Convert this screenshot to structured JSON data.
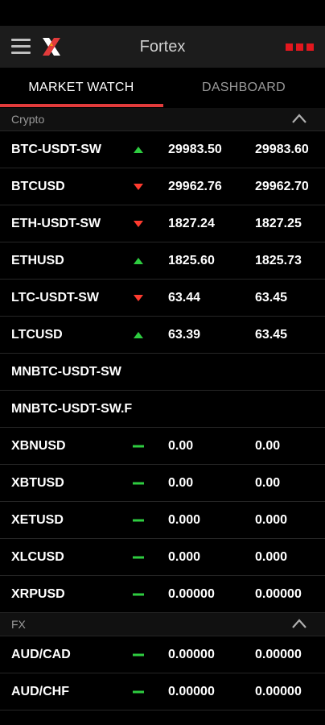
{
  "app": {
    "title": "Fortex"
  },
  "tabs": [
    {
      "label": "MARKET WATCH",
      "active": true
    },
    {
      "label": "DASHBOARD",
      "active": false
    }
  ],
  "sections": [
    {
      "name": "Crypto",
      "collapse_icon": "chevron-up-icon"
    },
    {
      "name": "FX",
      "collapse_icon": "chevron-up-icon"
    }
  ],
  "rows": [
    {
      "symbol": "BTC-USDT-SW",
      "trend": "up",
      "bid": "29983.50",
      "ask": "29983.60"
    },
    {
      "symbol": "BTCUSD",
      "trend": "down",
      "bid": "29962.76",
      "ask": "29962.70"
    },
    {
      "symbol": "ETH-USDT-SW",
      "trend": "down",
      "bid": "1827.24",
      "ask": "1827.25"
    },
    {
      "symbol": "ETHUSD",
      "trend": "up",
      "bid": "1825.60",
      "ask": "1825.73"
    },
    {
      "symbol": "LTC-USDT-SW",
      "trend": "down",
      "bid": "63.44",
      "ask": "63.45"
    },
    {
      "symbol": "LTCUSD",
      "trend": "up",
      "bid": "63.39",
      "ask": "63.45"
    },
    {
      "symbol": "MNBTC-USDT-SW",
      "trend": "none",
      "bid": "",
      "ask": ""
    },
    {
      "symbol": "MNBTC-USDT-SW.F",
      "trend": "none",
      "bid": "",
      "ask": ""
    },
    {
      "symbol": "XBNUSD",
      "trend": "flat",
      "bid": "0.00",
      "ask": "0.00"
    },
    {
      "symbol": "XBTUSD",
      "trend": "flat",
      "bid": "0.00",
      "ask": "0.00"
    },
    {
      "symbol": "XETUSD",
      "trend": "flat",
      "bid": "0.000",
      "ask": "0.000"
    },
    {
      "symbol": "XLCUSD",
      "trend": "flat",
      "bid": "0.000",
      "ask": "0.000"
    },
    {
      "symbol": "XRPUSD",
      "trend": "flat",
      "bid": "0.00000",
      "ask": "0.00000"
    },
    {
      "symbol": "AUD/CAD",
      "trend": "flat",
      "bid": "0.00000",
      "ask": "0.00000"
    },
    {
      "symbol": "AUD/CHF",
      "trend": "flat",
      "bid": "0.00000",
      "ask": "0.00000"
    }
  ],
  "colors": {
    "up": "#2ecc40",
    "down": "#ff3b2f",
    "flat": "#2ecc40",
    "accent": "#e23b3b",
    "menu_dots": "#e3171e"
  }
}
